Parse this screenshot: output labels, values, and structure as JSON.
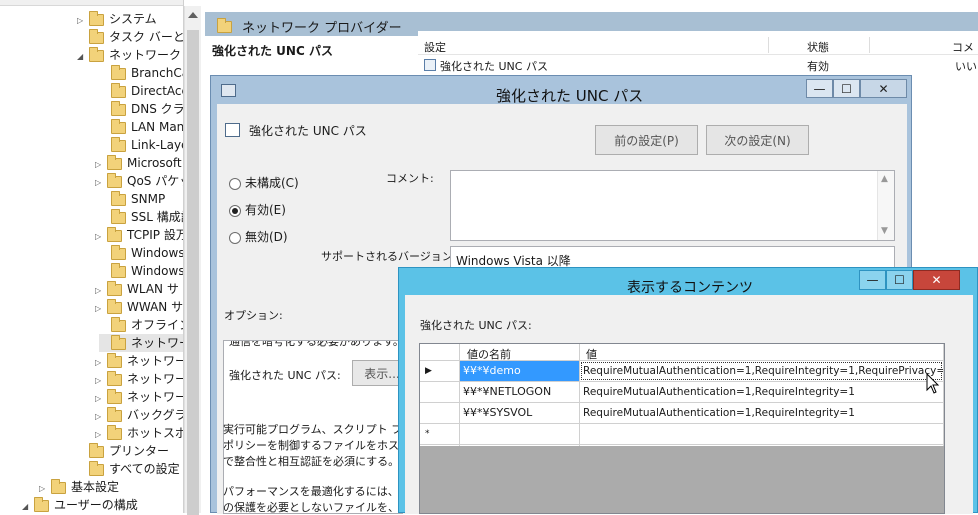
{
  "tree": {
    "items": [
      {
        "label": "システム",
        "toggle": "▷"
      },
      {
        "label": "タスク バーと [ス",
        "toggle": ""
      },
      {
        "label": "ネットワーク",
        "toggle": "◢"
      },
      {
        "label": "BranchCa",
        "toggle": ""
      },
      {
        "label": "DirectAcc",
        "toggle": ""
      },
      {
        "label": "DNS クライ",
        "toggle": ""
      },
      {
        "label": "LAN Mana",
        "toggle": ""
      },
      {
        "label": "Link-Laye",
        "toggle": ""
      },
      {
        "label": "Microsoft",
        "toggle": "▷"
      },
      {
        "label": "QoS パケッ",
        "toggle": "▷"
      },
      {
        "label": "SNMP",
        "toggle": ""
      },
      {
        "label": "SSL 構成設",
        "toggle": ""
      },
      {
        "label": "TCPIP 設万",
        "toggle": "▷"
      },
      {
        "label": "Windows",
        "toggle": ""
      },
      {
        "label": "Windows",
        "toggle": ""
      },
      {
        "label": "WLAN サ",
        "toggle": "▷"
      },
      {
        "label": "WWAN サ",
        "toggle": "▷"
      },
      {
        "label": "オフライン フ",
        "toggle": ""
      },
      {
        "label": "ネットワーク",
        "toggle": ""
      },
      {
        "label": "ネットワーク",
        "toggle": "▷"
      },
      {
        "label": "ネットワーク",
        "toggle": "▷"
      },
      {
        "label": "ネットワーク",
        "toggle": "▷"
      },
      {
        "label": "バックグラウ",
        "toggle": "▷"
      },
      {
        "label": "ホットスポッ",
        "toggle": "▷"
      },
      {
        "label": "プリンター",
        "toggle": ""
      },
      {
        "label": "すべての設定",
        "toggle": ""
      },
      {
        "label": "基本設定",
        "toggle": "▷"
      },
      {
        "label": "ユーザーの構成",
        "toggle": "◢"
      }
    ]
  },
  "right_pane": {
    "header": "ネットワーク プロバイダー",
    "policy_title": "強化された UNC パス",
    "columns": [
      "設定",
      "状態",
      "コメ"
    ],
    "row": {
      "setting": "強化された UNC パス",
      "state": "有効",
      "comment": "いい"
    }
  },
  "dialog": {
    "title": "強化された UNC パス",
    "policy_name": "強化された UNC パス",
    "prev_button": "前の設定(P)",
    "next_button": "次の設定(N)",
    "radio_unconfigured": "未構成(C)",
    "radio_enabled": "有効(E)",
    "radio_disabled": "無効(D)",
    "comment_label": "コメント:",
    "supported_label": "サポートされるバージョン:",
    "supported_value": "Windows Vista 以降",
    "options_label": "オプション:",
    "option_top_partial": "通信を暗号化する必要があります。",
    "unc_label": "強化された UNC パス:",
    "show_button": "表示...",
    "help_line1": "実行可能プログラム、スクリプト ファイ",
    "help_line2": "ポリシーを制御するファイルをホストす",
    "help_line3": "で整合性と相互認証を必須にする。",
    "help_line4": "パフォーマンスを最適化するには、整",
    "help_line5": "の保護を必要としないファイルを、こ"
  },
  "content_dialog": {
    "title": "表示するコンテンツ",
    "label": "強化された UNC パス:",
    "columns": [
      "値の名前",
      "値"
    ],
    "rows": [
      {
        "marker": "▶",
        "name": "¥¥*¥demo",
        "value": "RequireMutualAuthentication=1,RequireIntegrity=1,RequirePrivacy=1"
      },
      {
        "marker": "",
        "name": "¥¥*¥NETLOGON",
        "value": "RequireMutualAuthentication=1,RequireIntegrity=1"
      },
      {
        "marker": "",
        "name": "¥¥*¥SYSVOL",
        "value": "RequireMutualAuthentication=1,RequireIntegrity=1"
      },
      {
        "marker": "*",
        "name": "",
        "value": ""
      }
    ]
  },
  "window_buttons": {
    "minimize": "—",
    "maximize": "☐",
    "close": "✕"
  },
  "colors": {
    "selection": "#3399ff",
    "title_active": "#5bc2e7",
    "close_red": "#c7463b"
  }
}
